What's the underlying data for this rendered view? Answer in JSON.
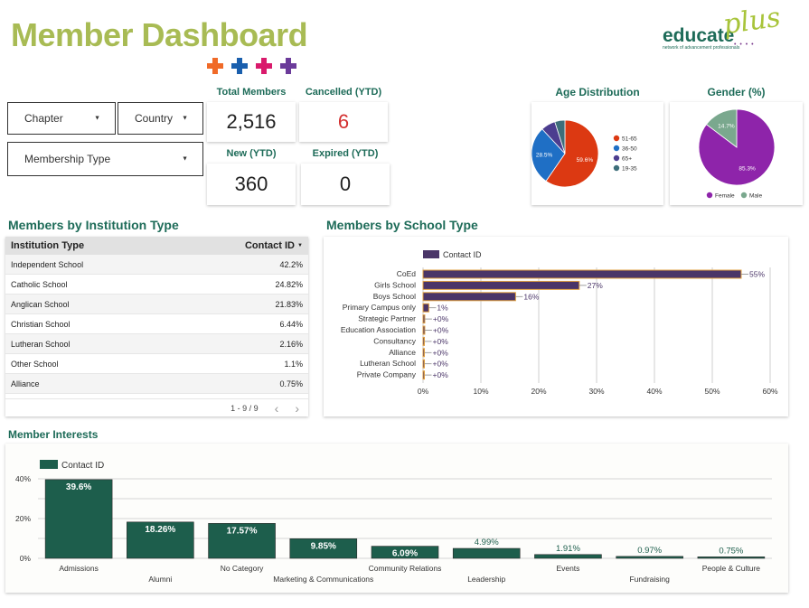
{
  "header": {
    "title": "Member Dashboard",
    "crosses": [
      "#f06a28",
      "#1a5fad",
      "#d91a6c",
      "#6b3b9a"
    ],
    "logo_main": "educate",
    "logo_plus": "plus",
    "logo_tag": "network of advancement professionals",
    "logo_dots": "• • • •"
  },
  "filters": {
    "chapter": "Chapter",
    "country": "Country",
    "membership_type": "Membership Type"
  },
  "kpis": {
    "total_members": {
      "label": "Total Members",
      "value": "2,516"
    },
    "cancelled": {
      "label": "Cancelled (YTD)",
      "value": "6",
      "color": "#d32f2f"
    },
    "new": {
      "label": "New (YTD)",
      "value": "360"
    },
    "expired": {
      "label": "Expired (YTD)",
      "value": "0"
    }
  },
  "age_title": "Age Distribution",
  "gender_title": "Gender (%)",
  "institution_title": "Members by Institution Type",
  "school_title": "Members by School Type",
  "interests_title": "Member Interests",
  "institution_table": {
    "col1": "Institution Type",
    "col2": "Contact ID",
    "sort_icon": "▼",
    "rows": [
      {
        "name": "Independent School",
        "value": "42.2%"
      },
      {
        "name": "Catholic School",
        "value": "24.82%"
      },
      {
        "name": "Anglican School",
        "value": "21.83%"
      },
      {
        "name": "Christian School",
        "value": "6.44%"
      },
      {
        "name": "Lutheran School",
        "value": "2.16%"
      },
      {
        "name": "Other School",
        "value": "1.1%"
      },
      {
        "name": "Alliance",
        "value": "0.75%"
      }
    ],
    "pagination": "1 - 9 / 9",
    "prev": "‹",
    "next": "›"
  },
  "chart_data": [
    {
      "type": "pie",
      "title": "Age Distribution",
      "categories": [
        "51-65",
        "36-50",
        "65+",
        "19-35"
      ],
      "values": [
        59.6,
        28.5,
        7.0,
        4.9
      ],
      "labels": [
        "59.6%",
        "28.5%",
        "",
        ""
      ],
      "colors": [
        "#dc3912",
        "#1f6fc5",
        "#4c3d8f",
        "#3d6e7a"
      ],
      "legend": "right"
    },
    {
      "type": "pie",
      "title": "Gender (%)",
      "categories": [
        "Female",
        "Male"
      ],
      "values": [
        85.3,
        14.7
      ],
      "labels": [
        "85.3%",
        "14.7%"
      ],
      "colors": [
        "#8e24aa",
        "#7aa88e"
      ],
      "legend": "bottom"
    },
    {
      "type": "bar",
      "orientation": "horizontal",
      "title": "Members by School Type",
      "series": [
        {
          "name": "Contact ID",
          "color": "#4a3568"
        }
      ],
      "categories": [
        "CoEd",
        "Girls School",
        "Boys School",
        "Primary Campus only",
        "Strategic Partner",
        "Education Association",
        "Consultancy",
        "Alliance",
        "Lutheran School",
        "Private Company"
      ],
      "values": [
        55,
        27,
        16,
        1,
        0.3,
        0.3,
        0.2,
        0.2,
        0.1,
        0.1
      ],
      "labels": [
        "55%",
        "27%",
        "16%",
        "1%",
        "+0%",
        "+0%",
        "+0%",
        "+0%",
        "+0%",
        "+0%"
      ],
      "xlim": [
        0,
        60
      ],
      "ticks": [
        "0%",
        "10%",
        "20%",
        "30%",
        "40%",
        "50%",
        "60%"
      ],
      "legend": "top-left"
    },
    {
      "type": "bar",
      "title": "Member Interests",
      "series": [
        {
          "name": "Contact ID",
          "color": "#1d5e4c"
        }
      ],
      "categories": [
        "Admissions",
        "Alumni",
        "No Category",
        "Marketing & Communications",
        "Community Relations",
        "Leadership",
        "Events",
        "Fundraising",
        "People & Culture"
      ],
      "values": [
        39.6,
        18.26,
        17.57,
        9.85,
        6.09,
        4.99,
        1.91,
        0.97,
        0.75
      ],
      "labels": [
        "39.6%",
        "18.26%",
        "17.57%",
        "9.85%",
        "6.09%",
        "4.99%",
        "1.91%",
        "0.97%",
        "0.75%"
      ],
      "ylim": [
        0,
        40
      ],
      "ticks": [
        "0%",
        "20%",
        "40%"
      ],
      "legend": "top-left"
    }
  ]
}
